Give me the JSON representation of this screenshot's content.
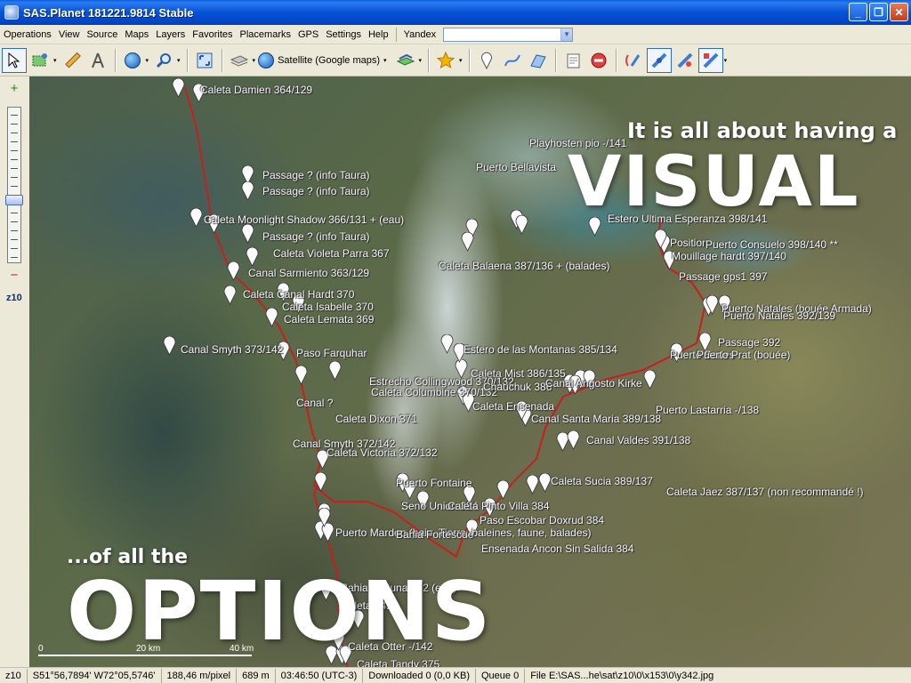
{
  "window": {
    "title": "SAS.Planet 181221.9814 Stable",
    "btn_min": "_",
    "btn_max": "❐",
    "btn_close": "✕"
  },
  "menu": {
    "items": [
      "Operations",
      "View",
      "Source",
      "Maps",
      "Layers",
      "Favorites",
      "Placemarks",
      "GPS",
      "Settings",
      "Help"
    ],
    "yandex_label": "Yandex",
    "dd": "▼"
  },
  "toolbar": {
    "map_source": "Satellite (Google maps)",
    "arrow": "▾"
  },
  "zoom": {
    "in": "+",
    "out": "−",
    "level_label": "z10",
    "level": 10
  },
  "overlay": {
    "line1": "It is all about having a",
    "line2": "VISUAL",
    "line3": "...of all the",
    "line4": "OPTIONS"
  },
  "scale": {
    "left": "0",
    "mid": "20 km",
    "right": "40 km"
  },
  "places": [
    {
      "text": "Caleta Damien 364/129"
    },
    {
      "text": "Playhosten pio  -/141"
    },
    {
      "text": "Puerto Bellavista"
    },
    {
      "text": "Passage ? (info Taura)"
    },
    {
      "text": "Passage ? (info Taura)"
    },
    {
      "text": "Caleta Moonlight Shadow 366/131 + (eau)"
    },
    {
      "text": "Estero Ultima Esperanza 398/141"
    },
    {
      "text": "Passage ? (info Taura)"
    },
    {
      "text": "Caleta Violeta Parra 367"
    },
    {
      "text": "Position"
    },
    {
      "text": "Puerto Consuelo 398/140 **"
    },
    {
      "text": "Mouillage hardt 397/140"
    },
    {
      "text": "Caleta Balaena 387/136 + (balades)"
    },
    {
      "text": "Canal Sarmiento 363/129"
    },
    {
      "text": "Passage gps1 397"
    },
    {
      "text": "Caleta Canal Hardt 370"
    },
    {
      "text": "Caleta Isabelle 370"
    },
    {
      "text": "Caleta Lemata 369"
    },
    {
      "text": "Puerto Natales (bouée Armada)"
    },
    {
      "text": "Puerto Natales 392/139"
    },
    {
      "text": "Canal Smyth 373/142"
    },
    {
      "text": "Estero de las Montanas 385/134"
    },
    {
      "text": "Paso Farquhar"
    },
    {
      "text": "Passage 392"
    },
    {
      "text": "Puerto Bories"
    },
    {
      "text": "Puerto Prat (bouée)"
    },
    {
      "text": "Caleta Mist 386/135"
    },
    {
      "text": "Estrecho Collingwood 370/132"
    },
    {
      "text": "Caleta Columbine 370/132"
    },
    {
      "text": "Chauchuk 386"
    },
    {
      "text": "Canal Angosto Kirke"
    },
    {
      "text": "Canal ?"
    },
    {
      "text": "Caleta Ensenada"
    },
    {
      "text": "Canal Santa Maria 389/138"
    },
    {
      "text": "Caleta Dixon 371"
    },
    {
      "text": "Canal Valdes 391/138"
    },
    {
      "text": "Canal Smyth 372/142"
    },
    {
      "text": "Caleta Victoria 372/132"
    },
    {
      "text": "Puerto Lastarria -/138"
    },
    {
      "text": "Caleta Sucia 389/137"
    },
    {
      "text": "Caleta Jaez 387/137 (non recommandé !)"
    },
    {
      "text": "Puerto Fontaine"
    },
    {
      "text": "Seno Union 384"
    },
    {
      "text": "Caleta Pinto Villa 384"
    },
    {
      "text": "Paso Escobar Doxrud 384"
    },
    {
      "text": "Puerto Mardon (baie, Tierra, baleines, faune, balades)"
    },
    {
      "text": "Bahia Fortescue"
    },
    {
      "text": "Ensenada Ancon Sin Salida 384"
    },
    {
      "text": "Bahia Fortuna 342 (eau)"
    },
    {
      "text": "Caleta 342"
    },
    {
      "text": "Caleta Otter -/142"
    },
    {
      "text": "Caleta Tandy 375"
    }
  ],
  "status": {
    "zoom": "z10",
    "coords": "S51°56,7894' W72°05,5746'",
    "resolution": "188,46 m/pixel",
    "altitude": "689 m",
    "time": "03:46:50 (UTC-3)",
    "downloaded": "Downloaded 0 (0,0 KB)",
    "queue": "Queue 0",
    "file": "File E:\\SAS...he\\sat\\z10\\0\\x153\\0\\y342.jpg"
  },
  "colors": {
    "route": "#c81e1e",
    "title_bar": "#0552d6",
    "chrome": "#ece9d8"
  }
}
